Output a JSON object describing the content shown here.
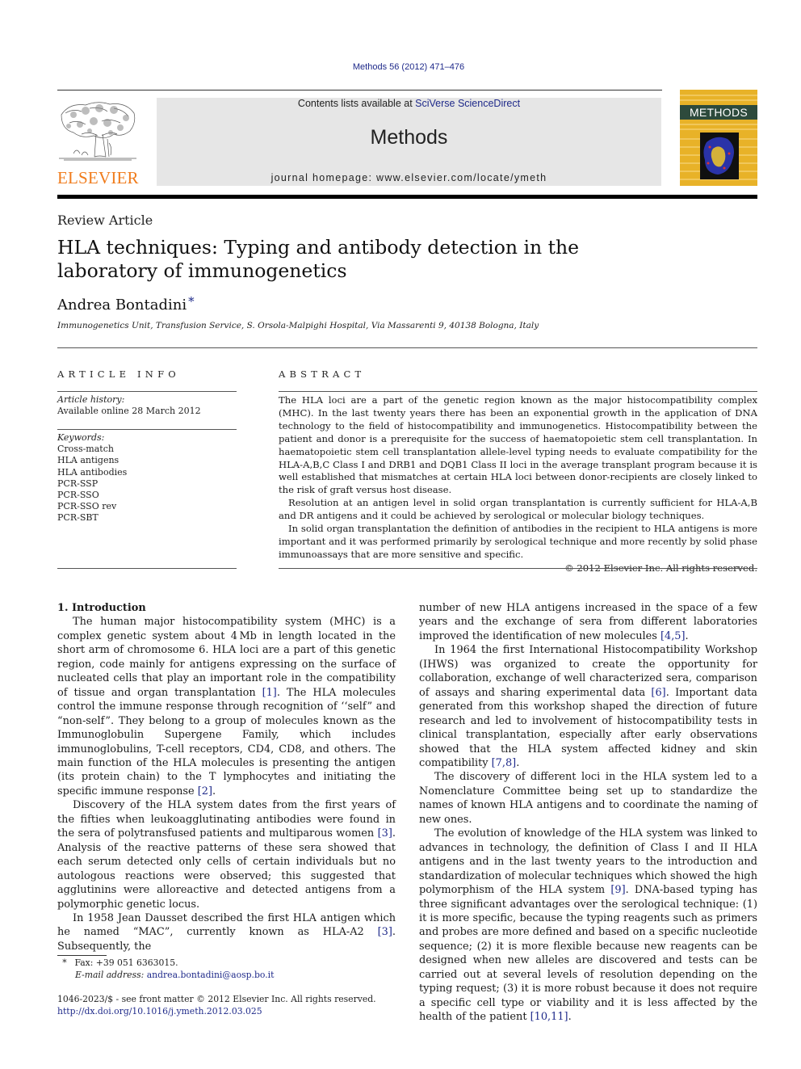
{
  "header": {
    "journal_ref": "Methods 56 (2012) 471–476",
    "contents_prefix": "Contents lists available at ",
    "contents_link": "SciVerse ScienceDirect",
    "journal_title": "Methods",
    "homepage": "journal homepage: www.elsevier.com/locate/ymeth",
    "publisher_logo_text": "ELSEVIER",
    "cover_title": "METHODS",
    "brand_color": "#f07c1c",
    "link_color": "#1f2a8a"
  },
  "article": {
    "type": "Review Article",
    "title": "HLA techniques: Typing and antibody detection in the laboratory of immunogenetics",
    "author": "Andrea Bontadini",
    "author_mark": "*",
    "affiliation": "Immunogenetics Unit, Transfusion Service, S. Orsola-Malpighi Hospital, Via Massarenti 9, 40138 Bologna, Italy"
  },
  "article_info": {
    "heading": "ARTICLE INFO",
    "history_label": "Article history:",
    "history_value": "Available online 28 March 2012",
    "keywords_label": "Keywords:",
    "keywords": [
      "Cross-match",
      "HLA antigens",
      "HLA antibodies",
      "PCR-SSP",
      "PCR-SSO",
      "PCR-SSO rev",
      "PCR-SBT"
    ]
  },
  "abstract": {
    "heading": "ABSTRACT",
    "paragraphs": [
      "The HLA loci are a part of the genetic region known as the major histocompatibility complex (MHC). In the last twenty years there has been an exponential growth in the application of DNA technology to the field of histocompatibility and immunogenetics. Histocompatibility between the patient and donor is a prerequisite for the success of haematopoietic stem cell transplantation. In haematopoietic stem cell transplantation allele-level typing needs to evaluate compatibility for the HLA-A,B,C Class I and DRB1 and DQB1 Class II loci in the average transplant program because it is well established that mismatches at certain HLA loci between donor-recipients are closely linked to the risk of graft versus host disease.",
      "Resolution at an antigen level in solid organ transplantation is currently sufficient for HLA-A,B and DR antigens and it could be achieved by serological or molecular biology techniques.",
      "In solid organ transplantation the definition of antibodies in the recipient to HLA antigens is more important and it was performed primarily by serological technique and more recently by solid phase immunoassays that are more sensitive and specific."
    ],
    "copyright": "© 2012 Elsevier Inc. All rights reserved."
  },
  "body": {
    "section_heading": "1. Introduction",
    "col1": [
      {
        "text": "The human major histocompatibility system (MHC) is a complex genetic system about 4 Mb in length located in the short arm of chromosome 6. HLA loci are a part of this genetic region, code mainly for antigens expressing on the surface of nucleated cells that play an important role in the compatibility of tissue and organ transplantation ",
        "ref1": "[1]",
        "text2": ". The HLA molecules control the immune response through recognition of ‘‘self” and “non-self”. They belong to a group of molecules known as the Immunoglobulin Supergene Family, which includes immunoglobulins, T-cell receptors, CD4, CD8, and others. The main function of the HLA molecules is presenting the antigen (its protein chain) to the T lymphocytes and initiating the specific immune response ",
        "ref2": "[2]",
        "text3": "."
      },
      {
        "text": "Discovery of the HLA system dates from the first years of the fifties when leukoagglutinating antibodies were found in the sera of polytransfused patients and multiparous women ",
        "ref1": "[3]",
        "text2": ". Analysis of the reactive patterns of these sera showed that each serum detected only cells of certain individuals but no autologous reactions were observed; this suggested that agglutinins were alloreactive and detected antigens from a polymorphic genetic locus."
      },
      {
        "text": "In 1958 Jean Dausset described the first HLA antigen which he named “MAC”, currently known as HLA-A2 ",
        "ref1": "[3]",
        "text2": ". Subsequently, the"
      }
    ],
    "col2": [
      {
        "text": "number of new HLA antigens increased in the space of a few years and the exchange of sera from different laboratories improved the identification of new molecules ",
        "ref1": "[4,5]",
        "text2": "."
      },
      {
        "text": "In 1964 the first International Histocompatibility Workshop (IHWS) was organized to create the opportunity for collaboration, exchange of well characterized sera, comparison of assays and sharing experimental data ",
        "ref1": "[6]",
        "text2": ". Important data generated from this workshop shaped the direction of future research and led to involvement of histocompatibility tests in clinical transplantation, especially after early observations showed that the HLA system affected kidney and skin compatibility ",
        "ref2": "[7,8]",
        "text3": "."
      },
      {
        "text": "The discovery of different loci in the HLA system led to a Nomenclature Committee being set up to standardize the names of known HLA antigens and to coordinate the naming of new ones."
      },
      {
        "text": "The evolution of knowledge of the HLA system was linked to advances in technology, the definition of Class I and II HLA antigens and in the last twenty years to the introduction and standardization of molecular techniques which showed the high polymorphism of the HLA system ",
        "ref1": "[9]",
        "text2": ". DNA-based typing has three significant advantages over the serological technique: (1) it is more specific, because the typing reagents such as primers and probes are more defined and based on a specific nucleotide sequence; (2) it is more flexible because new reagents can be designed when new alleles are discovered and tests can be carried out at several levels of resolution depending on the typing request; (3) it is more robust because it does not require a specific cell type or viability and it is less affected by the health of the patient ",
        "ref2": "[10,11]",
        "text3": "."
      }
    ]
  },
  "footnote": {
    "mark": "*",
    "fax": "Fax: +39 051 6363015.",
    "email_label": "E-mail address:",
    "email": "andrea.bontadini@aosp.bo.it"
  },
  "front_matter": {
    "issn_line": "1046-2023/$ - see front matter © 2012 Elsevier Inc. All rights reserved.",
    "doi": "http://dx.doi.org/10.1016/j.ymeth.2012.03.025"
  }
}
